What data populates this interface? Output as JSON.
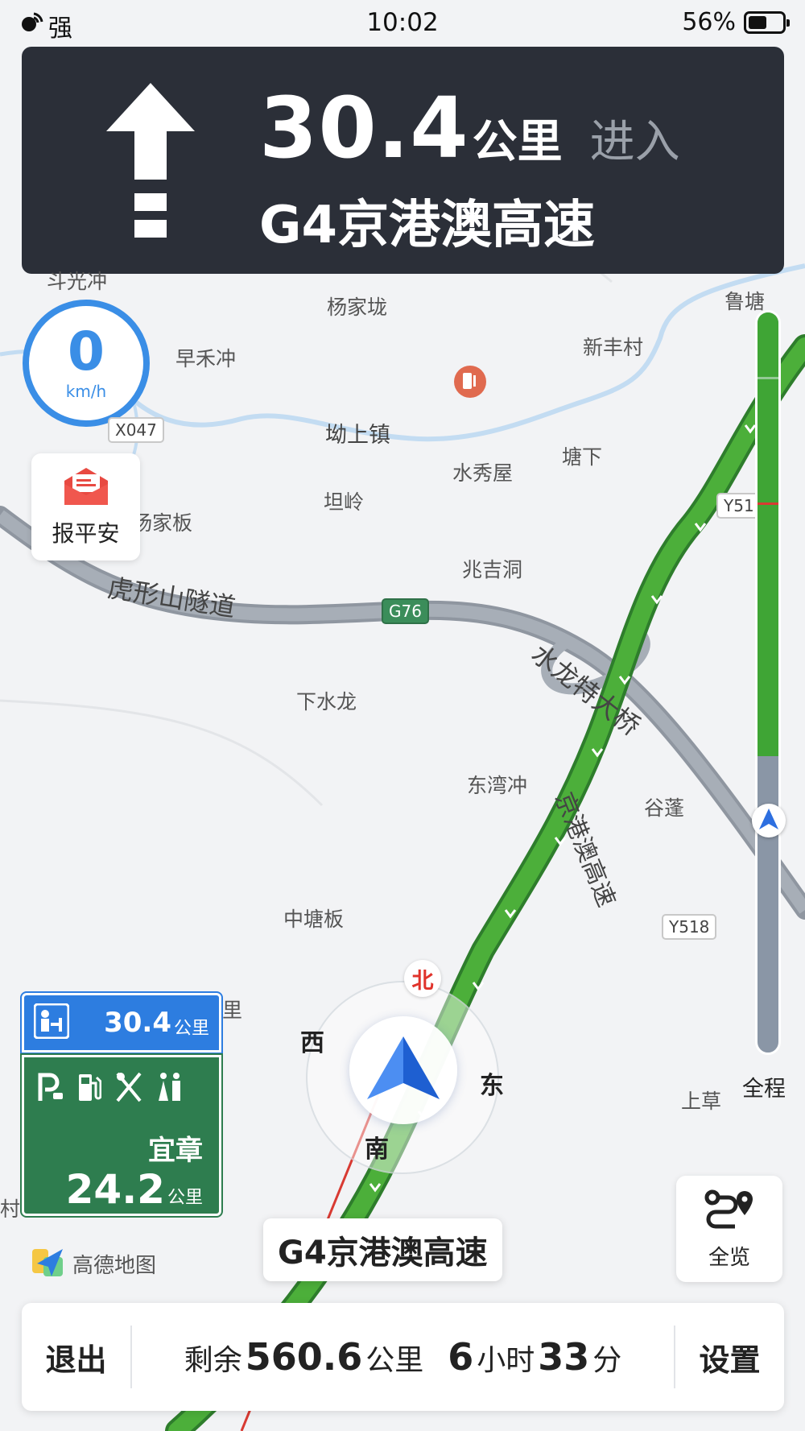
{
  "status_bar": {
    "signal": "强",
    "time": "10:02",
    "battery": "56%",
    "battery_level": 0.56
  },
  "guidance": {
    "distance_value": "30.4",
    "distance_unit": "公里",
    "action": "进入",
    "road": "G4京港澳高速"
  },
  "speed": {
    "value": "0",
    "unit": "km/h"
  },
  "report_button": {
    "label": "报平安"
  },
  "map": {
    "places": {
      "yangjialong": "杨家垅",
      "luxtang": "鲁塘",
      "xinfengcun": "新丰村",
      "zaohechong": "早禾冲",
      "aoshangzhen": "坳上镇",
      "tangxia": "塘下",
      "shuixiuwu": "水秀屋",
      "tanling": "坦岭",
      "yangjiaban": "杨家板",
      "zhaojidong": "兆吉洞",
      "xiashuilong": "下水龙",
      "dongwanchong": "东湾冲",
      "gupeng": "谷蓬",
      "zhongtangban": "中塘板",
      "shangcao": "上草",
      "doujiachong": "斗光冲",
      "li_fragment": "里",
      "cun_fragment": "村"
    },
    "shields": {
      "x047": "X047",
      "g76": "G76",
      "y51": "Y51",
      "y518": "Y518"
    },
    "road_labels": {
      "tunnel": "虎形山隧道",
      "bridge": "水龙特大桥",
      "g4_vertical": "京港澳高速"
    },
    "route_color": "#4caf3a",
    "road_grey": "#9aa1ab"
  },
  "compass": {
    "north": "北",
    "south": "南",
    "east": "东",
    "west": "西"
  },
  "progress": {
    "label": "全程",
    "remaining_fraction": 0.6,
    "jam_color": "#d83a32"
  },
  "service_area": {
    "distance_value": "30.4",
    "distance_unit": "公里",
    "next_name": "宜章",
    "next_distance_value": "24.2",
    "next_distance_unit": "公里",
    "icons": [
      "parking-icon",
      "fuel-icon",
      "restaurant-icon",
      "restroom-icon"
    ]
  },
  "logo": {
    "text": "高德地图"
  },
  "current_road": "G4京港澳高速",
  "overview_button": {
    "label": "全览"
  },
  "bottom_bar": {
    "exit_label": "退出",
    "remaining_prefix": "剩余",
    "remaining_distance": "560.6",
    "remaining_unit": "公里",
    "hours": "6",
    "hours_unit": "小时",
    "minutes": "33",
    "minutes_unit": "分",
    "settings_label": "设置"
  }
}
